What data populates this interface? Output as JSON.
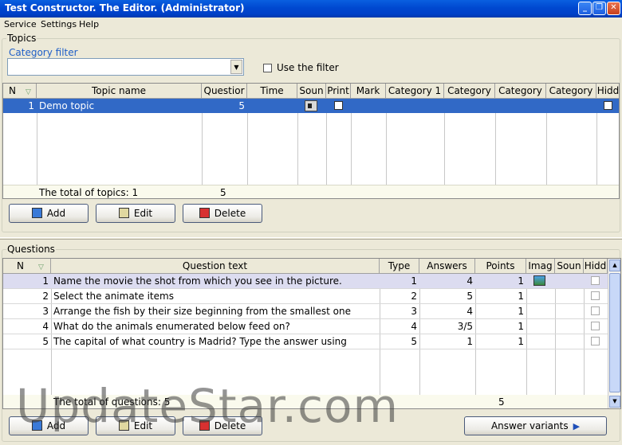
{
  "window": {
    "title": "Test Constructor. The Editor.  (Administrator)"
  },
  "menu": [
    "Service",
    "Settings",
    "Help"
  ],
  "topics": {
    "group_label": "Topics",
    "filter_label": "Category filter",
    "filter_value": "",
    "use_filter_label": "Use the filter",
    "headers": [
      "N",
      "Topic name",
      "Questior",
      "Time",
      "Soun",
      "Print",
      "Mark",
      "Category 1",
      "Category",
      "Category",
      "Category",
      "Hidd"
    ],
    "rows": [
      {
        "n": "1",
        "name": "Demo topic",
        "questions": "5",
        "time": ""
      }
    ],
    "total_label": "The total of topics: 1",
    "total_questions": "5",
    "buttons": {
      "add": "Add",
      "edit": "Edit",
      "delete": "Delete"
    }
  },
  "questions": {
    "group_label": "Questions",
    "headers": [
      "N",
      "Question text",
      "Type",
      "Answers",
      "Points",
      "Imag",
      "Soun",
      "Hidd"
    ],
    "rows": [
      {
        "n": "1",
        "text": "Name the movie the shot from which you see in the picture.",
        "type": "1",
        "answers": "4",
        "points": "1"
      },
      {
        "n": "2",
        "text": "Select the animate items",
        "type": "2",
        "answers": "5",
        "points": "1"
      },
      {
        "n": "3",
        "text": "Arrange the fish by their size beginning from the smallest one",
        "type": "3",
        "answers": "4",
        "points": "1"
      },
      {
        "n": "4",
        "text": "What do the animals enumerated below feed on?",
        "type": "4",
        "answers": "3/5",
        "points": "1"
      },
      {
        "n": "5",
        "text": "The capital of what country is Madrid? Type the answer using",
        "type": "5",
        "answers": "1",
        "points": "1"
      }
    ],
    "total_label": "The total of questions: 5",
    "total_points": "5",
    "buttons": {
      "add": "Add",
      "edit": "Edit",
      "delete": "Delete",
      "answer_variants": "Answer variants"
    }
  },
  "watermark": "UpdateStar.com",
  "colors": {
    "selection": "#3169c6",
    "titlebar": "#0048d0",
    "window_bg": "#ece9d8"
  }
}
